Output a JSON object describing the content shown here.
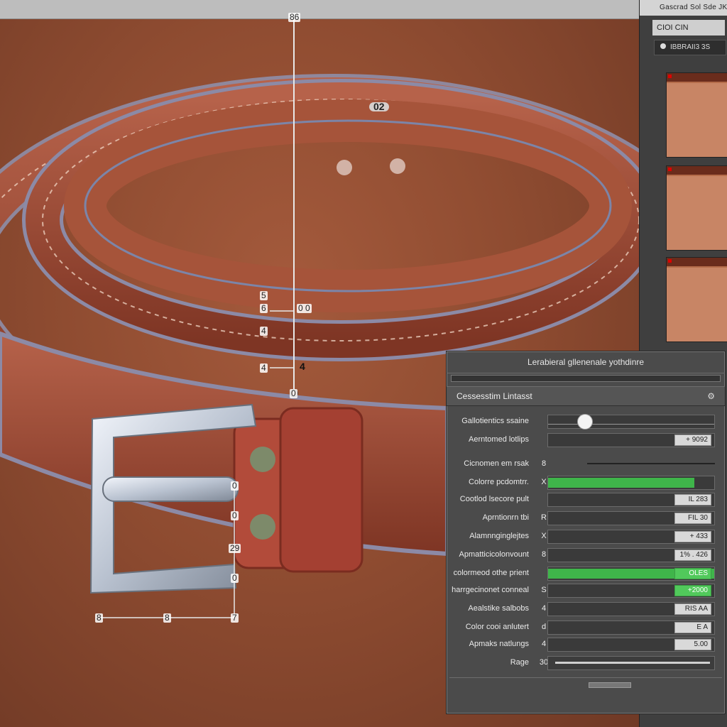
{
  "topbar": {
    "left_title": ""
  },
  "canvas": {
    "dimension_labels": {
      "top_ruler": "86",
      "belt_hole_label": "02",
      "left_stack_1": "5",
      "left_stack_2": "6",
      "left_stack_3": "4",
      "left_stack_4": "4",
      "left_stack_5": "4",
      "bottom_point": "0",
      "buckle_1": "0",
      "buckle_2": "0",
      "buckle_3": "29",
      "buckle_4": "0",
      "bottom_left": "8",
      "bottom_mid": "8",
      "bottom_right": "7",
      "side_marker": "0 0"
    }
  },
  "sidebar": {
    "header": "Gascrad  Sol Sde  JK",
    "subheader": "CIOI CIN",
    "row_label": "IBBRAII3 3S",
    "thumbnails": 3
  },
  "panel": {
    "title": "Lerabieral gllenenale yothdinre",
    "section": "Cessesstim Lintasst",
    "section_icon": "⚙",
    "rows": [
      {
        "label": "Gallotientics ssaine",
        "num": "",
        "type": "knob",
        "knob_pos": 0.22,
        "value": ""
      },
      {
        "label": "Aerntomed lotlips",
        "num": "",
        "type": "value",
        "fill": 0,
        "value": "+ 9092",
        "green": false
      },
      {
        "label": "Cicnomen em rsak",
        "num": "8",
        "type": "line",
        "fill": 0,
        "value": "",
        "green": false
      },
      {
        "label": "Colorre pcdomtrr.",
        "num": "X",
        "type": "fill",
        "fill": 0.88,
        "value": "",
        "green": false
      },
      {
        "label": "Cootlod lsecore pult",
        "num": "",
        "type": "value",
        "fill": 0,
        "value": "IL 283",
        "green": false
      },
      {
        "label": "Aprntionrn tbi",
        "num": "R",
        "type": "value",
        "fill": 0,
        "value": "FIL 30",
        "green": false
      },
      {
        "label": "Alamnnginglejtes",
        "num": "X",
        "type": "value",
        "fill": 0,
        "value": "+ 433",
        "green": false
      },
      {
        "label": "Apmatticicolonvount",
        "num": "8",
        "type": "value",
        "fill": 0,
        "value": "1% . 426",
        "green": false
      },
      {
        "label": "colormeod othe prient",
        "num": "",
        "type": "fill",
        "fill": 1.0,
        "value": "OLES",
        "green": true
      },
      {
        "label": "harrgecinonet conneal",
        "num": "S",
        "type": "value",
        "fill": 0,
        "value": "+2000",
        "green": true
      },
      {
        "label": "Aealstike salbobs",
        "num": "4",
        "type": "value",
        "fill": 0,
        "value": "RIS AA",
        "green": false
      },
      {
        "label": "Color cooi anlutert",
        "num": "d",
        "type": "value",
        "fill": 0,
        "value": "E A",
        "green": false
      },
      {
        "label": "Apmaks natlungs",
        "num": "4",
        "type": "value",
        "fill": 0,
        "value": "5.00",
        "green": false
      },
      {
        "label": "Rage",
        "num": "30",
        "type": "slider",
        "fill": 0,
        "value": "",
        "green": false
      }
    ]
  }
}
